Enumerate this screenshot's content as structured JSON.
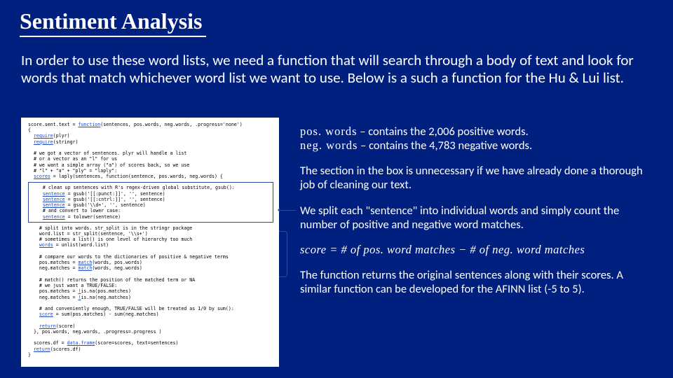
{
  "title": "Sentiment Analysis",
  "intro": "In order to use these word lists, we need a function that will search through a body of text and look for words that match whichever word list we want to use.  Below is a such a function for the Hu & Lui list.",
  "right": {
    "poswords_label": "pos. words",
    "poswords_text": " – contains the 2,006 positive words.",
    "negwords_label": "neg. words",
    "negwords_text": " – contains the 4,783 negative words.",
    "section_text": "The section in the box is unnecessary if we have already done a thorough job of cleaning our text.",
    "split_text": "We split each \"sentence\" into individual words and simply count the number of positive and negative word matches.",
    "formula": "score  =  # of pos. word matches  −  # of neg. word matches",
    "final_text": "The function returns the original sentences along with their scores. A similar function can be developed for the AFINN list (-5 to 5)."
  },
  "code": {
    "l01a": "score.sent.text = ",
    "l01b": "function",
    "l01c": "(sentences, pos.words, neg.words, .progress='none')",
    "l02": "{",
    "l03a": "  ",
    "l03b": "require",
    "l03c": "(plyr)",
    "l04a": "  ",
    "l04b": "require",
    "l04c": "(stringr)",
    "blank1": " ",
    "l05": "  # we got a vector of sentences. plyr will handle a list",
    "l06": "  # or a vector as an \"l\" for us",
    "l07": "  # we want a simple array (\"a\") of scores back, so we use",
    "l08": "  # \"l\" + \"a\" + \"ply\" = \"laply\":",
    "l09a": "  ",
    "l09b": "scores",
    "l09c": " = laply(sentences, function(sentence, pos.words, neg.words) {",
    "box": {
      "b1": "    # clean up sentences with R's regex-driven global substitute, gsub():",
      "b2a": "    ",
      "b2b": "sentence",
      "b2c": " = gsub('[[:punct:]]', '', sentence)",
      "b3a": "    ",
      "b3b": "sentence",
      "b3c": " = gsub('[[:cntrl:]]', '', sentence)",
      "b4a": "    ",
      "b4b": "sentence",
      "b4c": " = gsub('\\\\d+', '', sentence)",
      "b5": "    # and convert to lower case:",
      "b6a": "    ",
      "b6b": "sentence",
      "b6c": " = tolower(sentence)"
    },
    "l10": "    # split into words. str_split is in the stringr package",
    "l11": "    word.list = str_split(sentence, '\\\\s+')",
    "l12": "    # sometimes a list() is one level of hierarchy too much",
    "l13a": "    ",
    "l13b": "words",
    "l13c": " = unlist(word.list)",
    "blank2": " ",
    "l14": "    # compare our words to the dictionaries of positive & negative terms",
    "l15a": "    pos.matches = ",
    "l15b": "match",
    "l15c": "(words, pos.words)",
    "l16a": "    neg.matches = ",
    "l16b": "match",
    "l16c": "(words, neg.words)",
    "blank3": " ",
    "l17": "    # match() returns the position of the matched term or NA",
    "l18": "    # we just want a TRUE/FALSE:",
    "l19a": "    pos.matches = ",
    "l19b": "!",
    "l19c": "is.na(pos.matches)",
    "l20a": "    neg.matches = ",
    "l20b": "!",
    "l20c": "is.na(neg.matches)",
    "blank4": " ",
    "l21": "    # and conveniently enough, TRUE/FALSE will be treated as 1/0 by sum():",
    "l22a": "    ",
    "l22b": "score",
    "l22c": " = sum(pos.matches) - sum(neg.matches)",
    "blank5": " ",
    "l23a": "    ",
    "l23b": "return",
    "l23c": "(score)",
    "l24": "  }, pos.words, neg.words, .progress=.progress )",
    "blank6": " ",
    "l25a": "  scores.df = ",
    "l25b": "data.frame",
    "l25c": "(score=scores, text=sentences)",
    "l26a": "  ",
    "l26b": "return",
    "l26c": "(scores.df)",
    "l27": "}"
  }
}
